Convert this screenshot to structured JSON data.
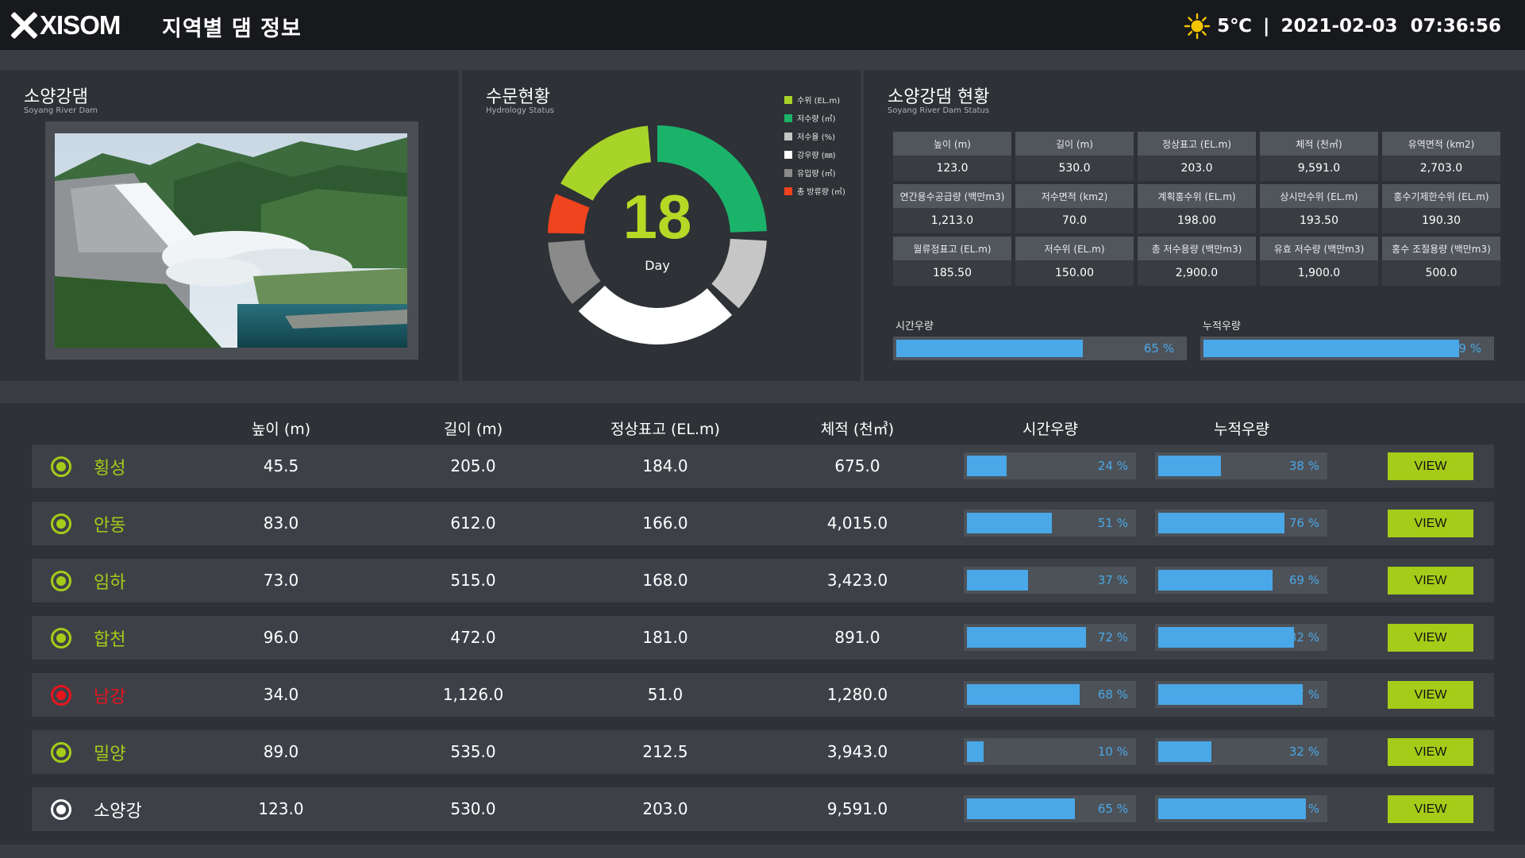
{
  "header": {
    "logo_text": "XISOM",
    "title": "지역별 댐 정보",
    "weather_icon": "sun-icon",
    "temperature": "5℃",
    "separator": "|",
    "datetime": "2021-02-03  07:36:56"
  },
  "dam_photo_panel": {
    "title": "소양강댐",
    "subtitle": "Soyang River Dam"
  },
  "hydrology": {
    "title": "수문현황",
    "subtitle": "Hydrology Status",
    "center_value": "18",
    "center_unit": "Day",
    "legend": [
      {
        "label": "수위 (EL.m)",
        "color": "#a8d42a"
      },
      {
        "label": "저수량 (㎥)",
        "color": "#1bb36a"
      },
      {
        "label": "저수율 (%)",
        "color": "#c6c6c6"
      },
      {
        "label": "강우량 (㎜)",
        "color": "#ffffff"
      },
      {
        "label": "유입량 (㎥)",
        "color": "#8a8a8a"
      },
      {
        "label": "총 방류량 (㎥)",
        "color": "#f0441e"
      }
    ]
  },
  "status_panel": {
    "title": "소양강댐 현황",
    "subtitle": "Soyang River Dam Status",
    "rows": [
      [
        {
          "label": "높이 (m)",
          "value": "123.0"
        },
        {
          "label": "길이 (m)",
          "value": "530.0"
        },
        {
          "label": "정상표고 (EL.m)",
          "value": "203.0"
        },
        {
          "label": "체적 (천㎥)",
          "value": "9,591.0"
        },
        {
          "label": "유역면적 (km2)",
          "value": "2,703.0"
        }
      ],
      [
        {
          "label": "연간용수공급량 (백만m3)",
          "value": "1,213.0"
        },
        {
          "label": "저수면적 (km2)",
          "value": "70.0"
        },
        {
          "label": "계획홍수위 (EL.m)",
          "value": "198.00"
        },
        {
          "label": "상시만수위 (EL.m)",
          "value": "193.50"
        },
        {
          "label": "홍수기제한수위 (EL.m)",
          "value": "190.30"
        }
      ],
      [
        {
          "label": "월류정표고 (EL.m)",
          "value": "185.50"
        },
        {
          "label": "저수위 (EL.m)",
          "value": "150.00"
        },
        {
          "label": "총 저수용량 (백만m3)",
          "value": "2,900.0"
        },
        {
          "label": "유효 저수량 (백만m3)",
          "value": "1,900.0"
        },
        {
          "label": "홍수 조절용량 (백만m3)",
          "value": "500.0"
        }
      ]
    ],
    "hourly_rain_label": "시간우량",
    "hourly_rain_pct": 65,
    "hourly_rain_text": "65 %",
    "cumulative_rain_label": "누적우량",
    "cumulative_rain_pct": 89,
    "cumulative_rain_text": "89 %"
  },
  "table": {
    "columns": [
      "높이 (m)",
      "길이 (m)",
      "정상표고 (EL.m)",
      "체적 (천㎥)",
      "시간우량",
      "누적우량"
    ],
    "view_label": "VIEW",
    "rows": [
      {
        "name": "횡성",
        "status": "normal",
        "height": "45.5",
        "length": "205.0",
        "crest": "184.0",
        "volume": "675.0",
        "hourly_pct": 24,
        "hourly_text": "24 %",
        "cum_pct": 38,
        "cum_text": "38 %"
      },
      {
        "name": "안동",
        "status": "normal",
        "height": "83.0",
        "length": "612.0",
        "crest": "166.0",
        "volume": "4,015.0",
        "hourly_pct": 51,
        "hourly_text": "51 %",
        "cum_pct": 76,
        "cum_text": "76 %"
      },
      {
        "name": "임하",
        "status": "normal",
        "height": "73.0",
        "length": "515.0",
        "crest": "168.0",
        "volume": "3,423.0",
        "hourly_pct": 37,
        "hourly_text": "37 %",
        "cum_pct": 69,
        "cum_text": "69 %"
      },
      {
        "name": "합천",
        "status": "normal",
        "height": "96.0",
        "length": "472.0",
        "crest": "181.0",
        "volume": "891.0",
        "hourly_pct": 72,
        "hourly_text": "72 %",
        "cum_pct": 82,
        "cum_text": "82 %"
      },
      {
        "name": "남강",
        "status": "alert",
        "height": "34.0",
        "length": "1,126.0",
        "crest": "51.0",
        "volume": "1,280.0",
        "hourly_pct": 68,
        "hourly_text": "68 %",
        "cum_pct": 87,
        "cum_text": "87 %"
      },
      {
        "name": "밀양",
        "status": "normal",
        "height": "89.0",
        "length": "535.0",
        "crest": "212.5",
        "volume": "3,943.0",
        "hourly_pct": 10,
        "hourly_text": "10 %",
        "cum_pct": 32,
        "cum_text": "32 %"
      },
      {
        "name": "소양강",
        "status": "selected",
        "height": "123.0",
        "length": "530.0",
        "crest": "203.0",
        "volume": "9,591.0",
        "hourly_pct": 65,
        "hourly_text": "65 %",
        "cum_pct": 89,
        "cum_text": "89 %"
      }
    ]
  },
  "colors": {
    "accent_green": "#a4cc18",
    "bar_blue": "#4aa8e8",
    "alert_red": "#e8141e",
    "selected_white": "#ffffff"
  }
}
